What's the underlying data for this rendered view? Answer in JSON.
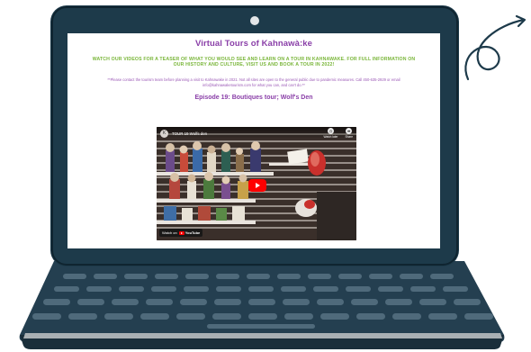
{
  "page": {
    "title": "Virtual Tours of Kahnawà:ke",
    "lead": "WATCH OUR VIDEOS FOR A TEASER OF WHAT YOU WOULD SEE AND LEARN ON A TOUR IN KAHNAWAKE. FOR FULL INFORMATION ON OUR HISTORY AND CULTURE, VISIT US AND BOOK A TOUR IN 2022!",
    "note": "**Please contact the tourism team before planning a visit to Kahnawake in 2021. Not all sites are open to the general public due to pandemic measures. Call 450-635-2929 or email info@kahnawaketourism.com for what you can, and can't do.**",
    "episode_title": "Episode 19: Boutiques tour; Wolf's Den"
  },
  "video": {
    "title": "TOUR 19 Wolfs den",
    "channel_icon": "K",
    "watch_later_label": "Watch later",
    "share_label": "Share",
    "watch_on_label": "Watch on",
    "platform_label": "YouTube"
  },
  "icons": {
    "play": "play-icon",
    "clock": "clock-icon",
    "share": "share-icon"
  },
  "colors": {
    "laptop_body": "#1d3a4a",
    "title": "#8a3fa8",
    "lead": "#7ab63a",
    "note": "#9b59b6",
    "youtube_red": "#ff0000"
  }
}
